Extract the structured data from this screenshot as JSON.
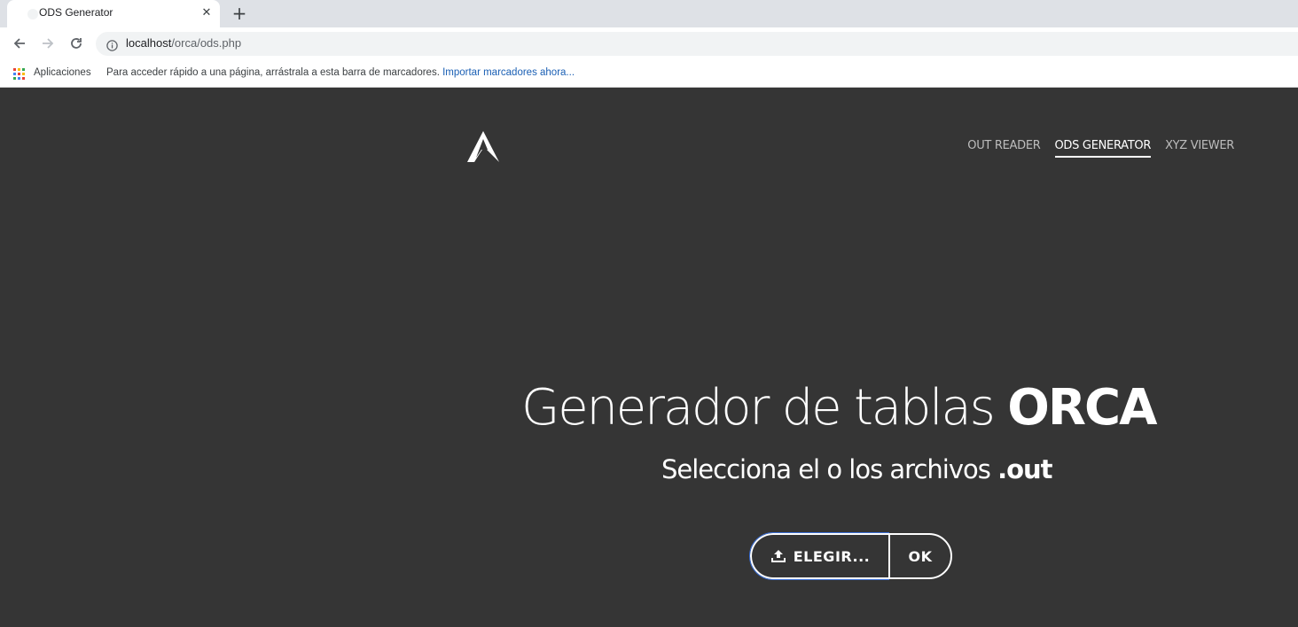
{
  "browser": {
    "tab": {
      "title": "ODS Generator",
      "close": "✕"
    },
    "newtab": "+",
    "url": {
      "host": "localhost",
      "path": "/orca/ods.php"
    },
    "bookmarks": {
      "apps_label": "Aplicaciones",
      "hint": "Para acceder rápido a una página, arrástrala a esta barra de marcadores.",
      "import_link": "Importar marcadores ahora..."
    }
  },
  "site": {
    "nav": {
      "items": [
        {
          "label": "OUT READER",
          "active": false
        },
        {
          "label": "ODS GENERATOR",
          "active": true
        },
        {
          "label": "XYZ VIEWER",
          "active": false
        }
      ]
    },
    "hero": {
      "title_light": "Generador de tablas",
      "title_bold": "ORCA",
      "subtitle_light": "Selecciona el o los archivos",
      "subtitle_bold": ".out"
    },
    "actions": {
      "choose_label": "ELEGIR...",
      "ok_label": "OK"
    }
  },
  "colors": {
    "page_bg": "#353535",
    "focus_outline": "#3a6fd8",
    "link_blue": "#1a5fb4"
  }
}
